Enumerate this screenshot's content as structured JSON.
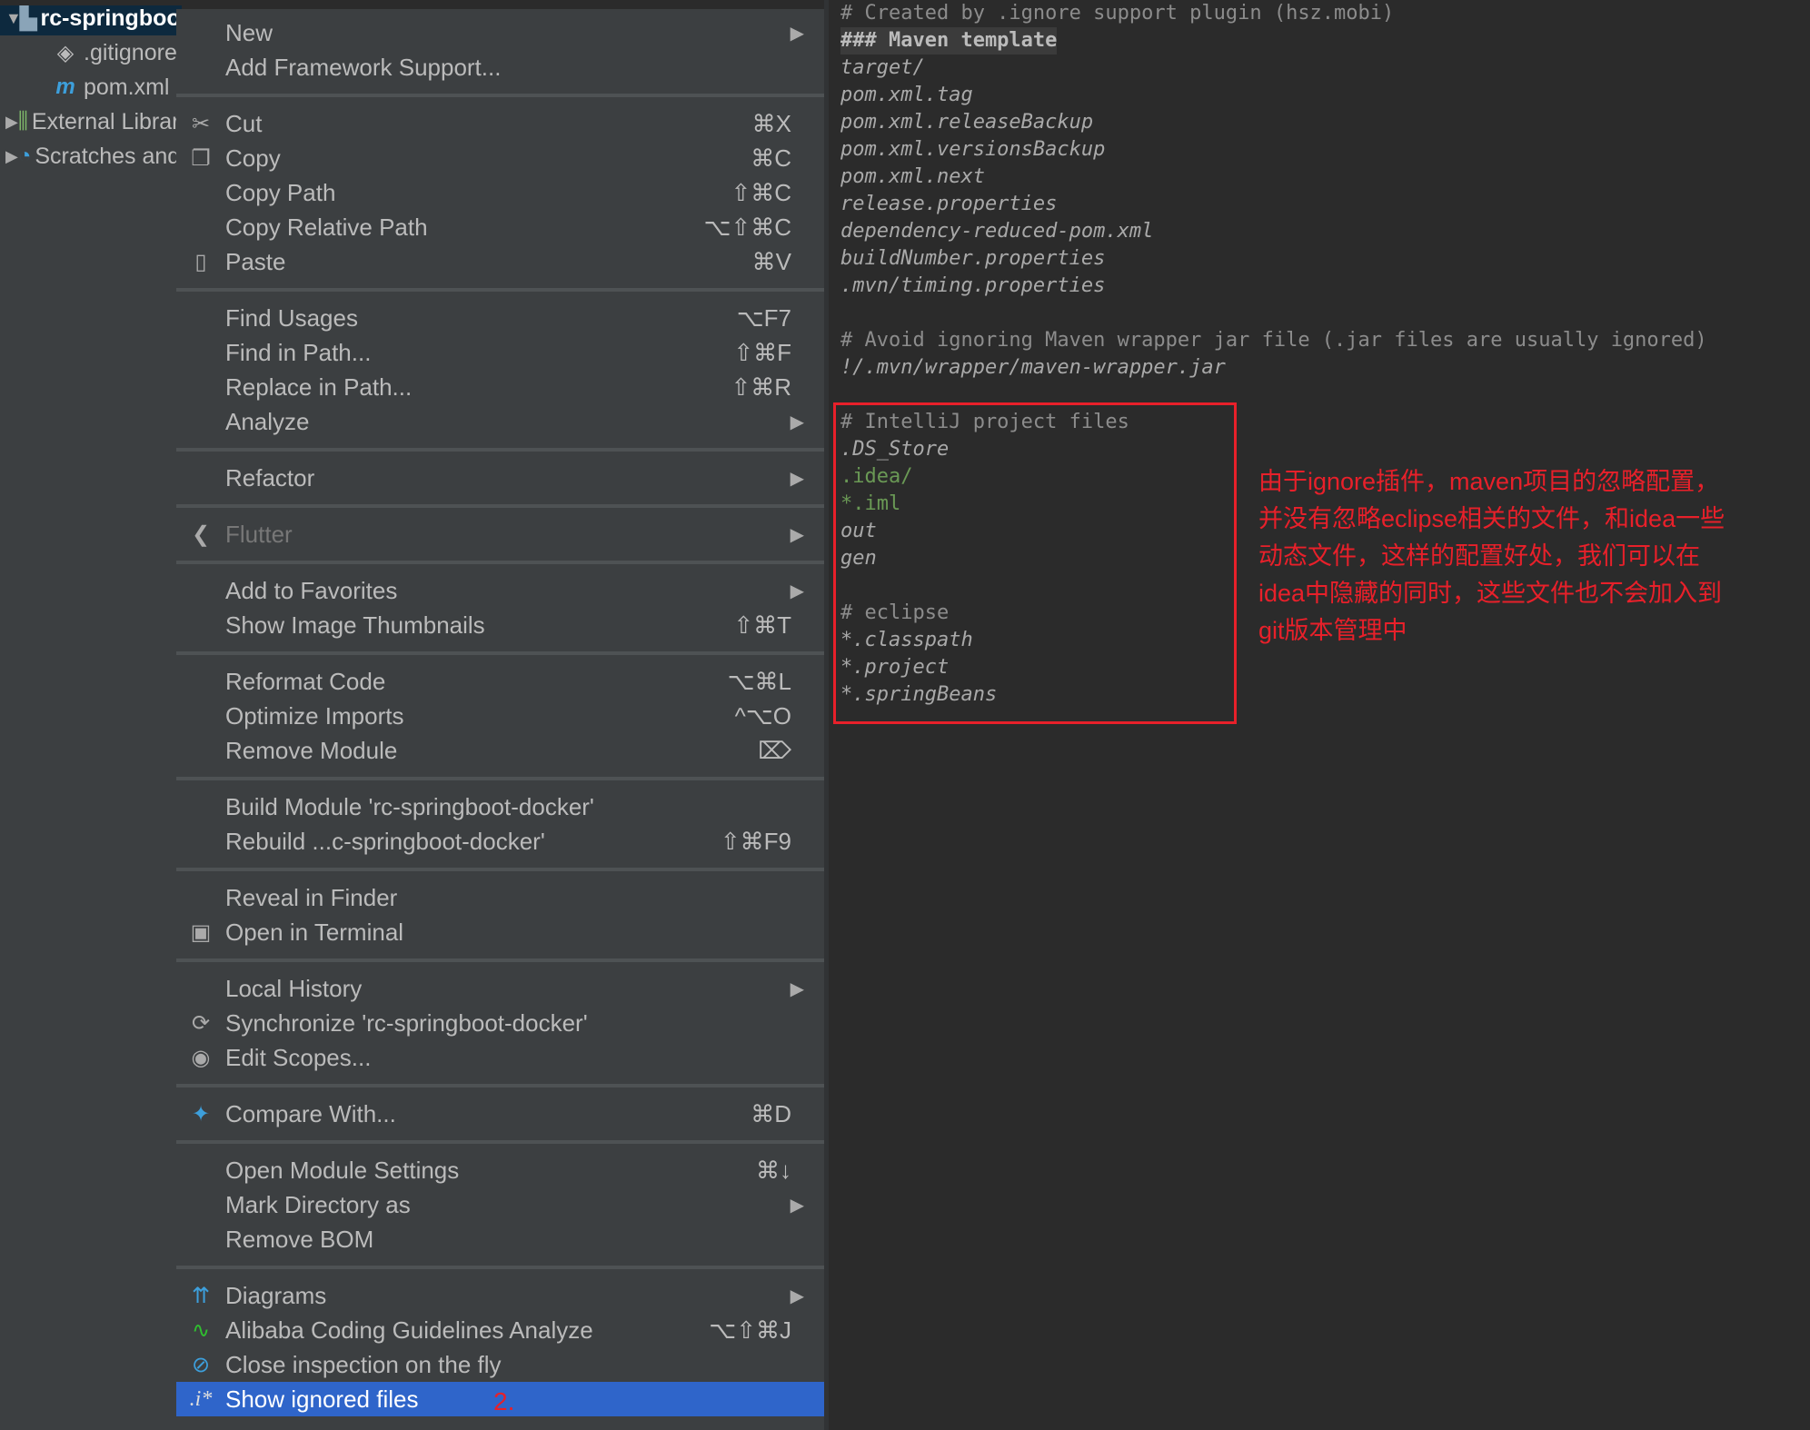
{
  "project_tree": [
    {
      "label": "rc-springboot-docker",
      "icon": "module-folder-icon",
      "glyph": "▙",
      "color": "#8aa4b8",
      "arrow": "▼",
      "selected": true
    },
    {
      "label": ".gitignore",
      "icon": "git-file-icon",
      "glyph": "◈",
      "color": "#bbbbbb",
      "arrow": ""
    },
    {
      "label": "pom.xml",
      "icon": "maven-icon",
      "glyph": "m",
      "color": "#3d9fdb",
      "arrow": ""
    },
    {
      "label": "External Libraries",
      "icon": "libraries-icon",
      "glyph": "⫼",
      "color": "#7fb86a",
      "arrow": "▶"
    },
    {
      "label": "Scratches and Consoles",
      "icon": "scratches-icon",
      "glyph": "◔",
      "color": "#3d9fdb",
      "arrow": "▶"
    }
  ],
  "context_menu": {
    "groups": [
      [
        {
          "label": "New",
          "submenu": true
        },
        {
          "label": "Add Framework Support..."
        }
      ],
      [
        {
          "label": "Cut",
          "shortcut": "⌘X",
          "icon": "scissors-icon",
          "glyph": "✂"
        },
        {
          "label": "Copy",
          "shortcut": "⌘C",
          "icon": "copy-icon",
          "glyph": "❐"
        },
        {
          "label": "Copy Path",
          "shortcut": "⇧⌘C"
        },
        {
          "label": "Copy Relative Path",
          "shortcut": "⌥⇧⌘C"
        },
        {
          "label": "Paste",
          "shortcut": "⌘V",
          "icon": "clipboard-icon",
          "glyph": "▯"
        }
      ],
      [
        {
          "label": "Find Usages",
          "shortcut": "⌥F7"
        },
        {
          "label": "Find in Path...",
          "shortcut": "⇧⌘F"
        },
        {
          "label": "Replace in Path...",
          "shortcut": "⇧⌘R"
        },
        {
          "label": "Analyze",
          "submenu": true
        }
      ],
      [
        {
          "label": "Refactor",
          "submenu": true
        }
      ],
      [
        {
          "label": "Flutter",
          "submenu": true,
          "disabled": true,
          "icon": "flutter-icon",
          "glyph": "❮"
        }
      ],
      [
        {
          "label": "Add to Favorites",
          "submenu": true
        },
        {
          "label": "Show Image Thumbnails",
          "shortcut": "⇧⌘T"
        }
      ],
      [
        {
          "label": "Reformat Code",
          "shortcut": "⌥⌘L"
        },
        {
          "label": "Optimize Imports",
          "shortcut": "^⌥O"
        },
        {
          "label": "Remove Module",
          "shortcut": "⌦"
        }
      ],
      [
        {
          "label": "Build Module 'rc-springboot-docker'"
        },
        {
          "label": "Rebuild ...c-springboot-docker'",
          "shortcut": "⇧⌘F9"
        }
      ],
      [
        {
          "label": "Reveal in Finder"
        },
        {
          "label": "Open in Terminal",
          "icon": "terminal-icon",
          "glyph": "▣"
        }
      ],
      [
        {
          "label": "Local History",
          "submenu": true
        },
        {
          "label": "Synchronize 'rc-springboot-docker'",
          "icon": "sync-icon",
          "glyph": "⟳"
        },
        {
          "label": "Edit Scopes...",
          "icon": "scope-icon",
          "glyph": "◉"
        }
      ],
      [
        {
          "label": "Compare With...",
          "shortcut": "⌘D",
          "icon": "compare-icon",
          "glyph": "✦",
          "color": "#3d9fdb"
        }
      ],
      [
        {
          "label": "Open Module Settings",
          "shortcut": "⌘↓"
        },
        {
          "label": "Mark Directory as",
          "submenu": true
        },
        {
          "label": "Remove BOM"
        }
      ],
      [
        {
          "label": "Diagrams",
          "submenu": true,
          "icon": "diagram-icon",
          "glyph": "⇈",
          "color": "#3d9fdb"
        },
        {
          "label": "Alibaba Coding Guidelines Analyze",
          "shortcut": "⌥⇧⌘J",
          "icon": "alibaba-analyze-icon",
          "glyph": "∿",
          "color": "#2fbf2f"
        },
        {
          "label": "Close inspection on the fly",
          "icon": "close-inspection-icon",
          "glyph": "⊘",
          "color": "#3d9fdb"
        },
        {
          "label": "Show ignored files",
          "highlighted": true,
          "icon": "ignored-files-icon",
          "glyph": ".i*"
        }
      ]
    ]
  },
  "editor": {
    "lines": [
      {
        "text": "# Created by .ignore support plugin (hsz.mobi)",
        "style": "comment"
      },
      {
        "text": "### Maven template",
        "style": "heading"
      },
      {
        "text": "target/"
      },
      {
        "text": "pom.xml.tag"
      },
      {
        "text": "pom.xml.releaseBackup"
      },
      {
        "text": "pom.xml.versionsBackup"
      },
      {
        "text": "pom.xml.next"
      },
      {
        "text": "release.properties"
      },
      {
        "text": "dependency-reduced-pom.xml"
      },
      {
        "text": "buildNumber.properties"
      },
      {
        "text": ".mvn/timing.properties"
      },
      {
        "text": ""
      },
      {
        "text": "# Avoid ignoring Maven wrapper jar file (.jar files are usually ignored)",
        "style": "comment"
      },
      {
        "text": "!/.mvn/wrapper/maven-wrapper.jar"
      },
      {
        "text": ""
      },
      {
        "text": "# IntelliJ project files",
        "style": "comment"
      },
      {
        "text": ".DS_Store"
      },
      {
        "text": ".idea/",
        "style": "green"
      },
      {
        "text": "*.iml",
        "style": "green"
      },
      {
        "text": "out"
      },
      {
        "text": "gen"
      },
      {
        "text": ""
      },
      {
        "text": "# eclipse",
        "style": "comment"
      },
      {
        "text": "*.classpath"
      },
      {
        "text": "*.project"
      },
      {
        "text": "*.springBeans"
      }
    ]
  },
  "annotation": {
    "lines": [
      "由于ignore插件，maven项目的忽略配置，",
      "并没有忽略eclipse相关的文件，和idea一些",
      "动态文件，这样的配置好处，我们可以在",
      "idea中隐藏的同时，这些文件也不会加入到",
      "git版本管理中"
    ],
    "step": "2.",
    "color": "#e8202a"
  }
}
